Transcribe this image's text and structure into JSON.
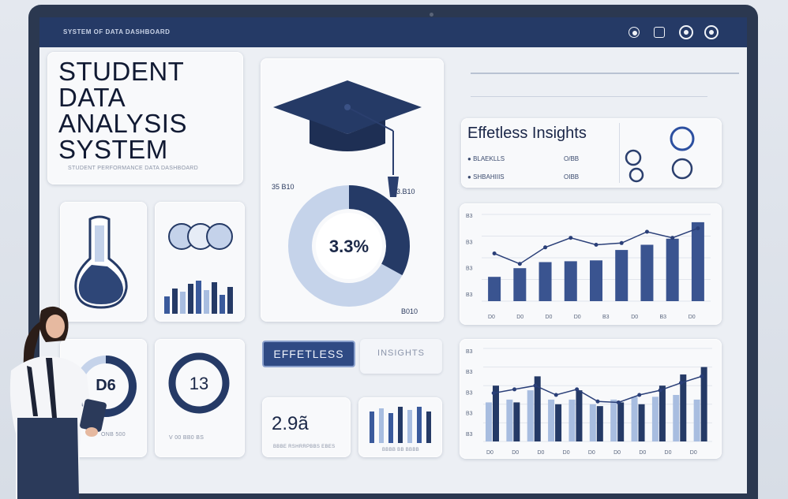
{
  "header": {
    "title": "SYSTEM OF DATA DASHBOARD",
    "icons": [
      "settings-icon",
      "image-icon",
      "record-icon",
      "power-icon"
    ]
  },
  "title_card": {
    "lines": [
      "STUDENT",
      "DATA",
      "ANALYSIS",
      "SYSTEM"
    ],
    "subtitle": "STUDENT PERFORMANCE DATA DASHBOARD"
  },
  "donut_card": {
    "left_label": "35 B10",
    "right_label": "3.B10",
    "bottom_label": "B010",
    "center_value": "3.3%",
    "percent": 33
  },
  "insights_card": {
    "title": "Effetless Insights",
    "rows": [
      {
        "label": "BLAEKLLS",
        "value": "O/BB"
      },
      {
        "label": "SHBAHIIIS",
        "value": "OIBB"
      }
    ]
  },
  "bar_line_chart": {
    "y_labels": [
      "B3",
      "B3",
      "B3",
      "B3"
    ],
    "x_labels": [
      "D0",
      "D0",
      "D0",
      "D0",
      "B3",
      "D0",
      "B3",
      "D0"
    ],
    "bars": [
      0.28,
      0.38,
      0.45,
      0.46,
      0.47,
      0.59,
      0.65,
      0.72,
      0.91
    ],
    "line": [
      0.55,
      0.43,
      0.62,
      0.73,
      0.65,
      0.67,
      0.8,
      0.73,
      0.84
    ]
  },
  "gauge_card": {
    "value": "D6",
    "label": "ONB 500"
  },
  "ring_card": {
    "value": "13",
    "label": "V 00 BB0 BS"
  },
  "effortless_pill": {
    "label": "EFFETLESS"
  },
  "insights_pill": {
    "label": "INSIGHTS"
  },
  "stat_card": {
    "value": "2.9ã",
    "label": "BBBE RSHRRPBBS EBES"
  },
  "mini_bars_card": {
    "label": "BBBB BB BBBB"
  },
  "grouped_chart": {
    "y_labels": [
      "B3",
      "B3",
      "B3",
      "B3",
      "B3"
    ],
    "x_labels": [
      "D0",
      "D0",
      "D0",
      "D0",
      "D0",
      "D0",
      "D0",
      "D0",
      "D0"
    ],
    "light": [
      0.42,
      0.45,
      0.55,
      0.45,
      0.45,
      0.4,
      0.45,
      0.48,
      0.48,
      0.5,
      0.45
    ],
    "dark": [
      0.6,
      0.42,
      0.7,
      0.4,
      0.55,
      0.38,
      0.42,
      0.4,
      0.6,
      0.72,
      0.8
    ],
    "line": [
      0.52,
      0.56,
      0.6,
      0.5,
      0.56,
      0.43,
      0.42,
      0.5,
      0.55,
      0.63,
      0.7
    ]
  },
  "colors": {
    "navy": "#253a66",
    "accent": "#3a5a9c",
    "light": "#a8bde0"
  }
}
